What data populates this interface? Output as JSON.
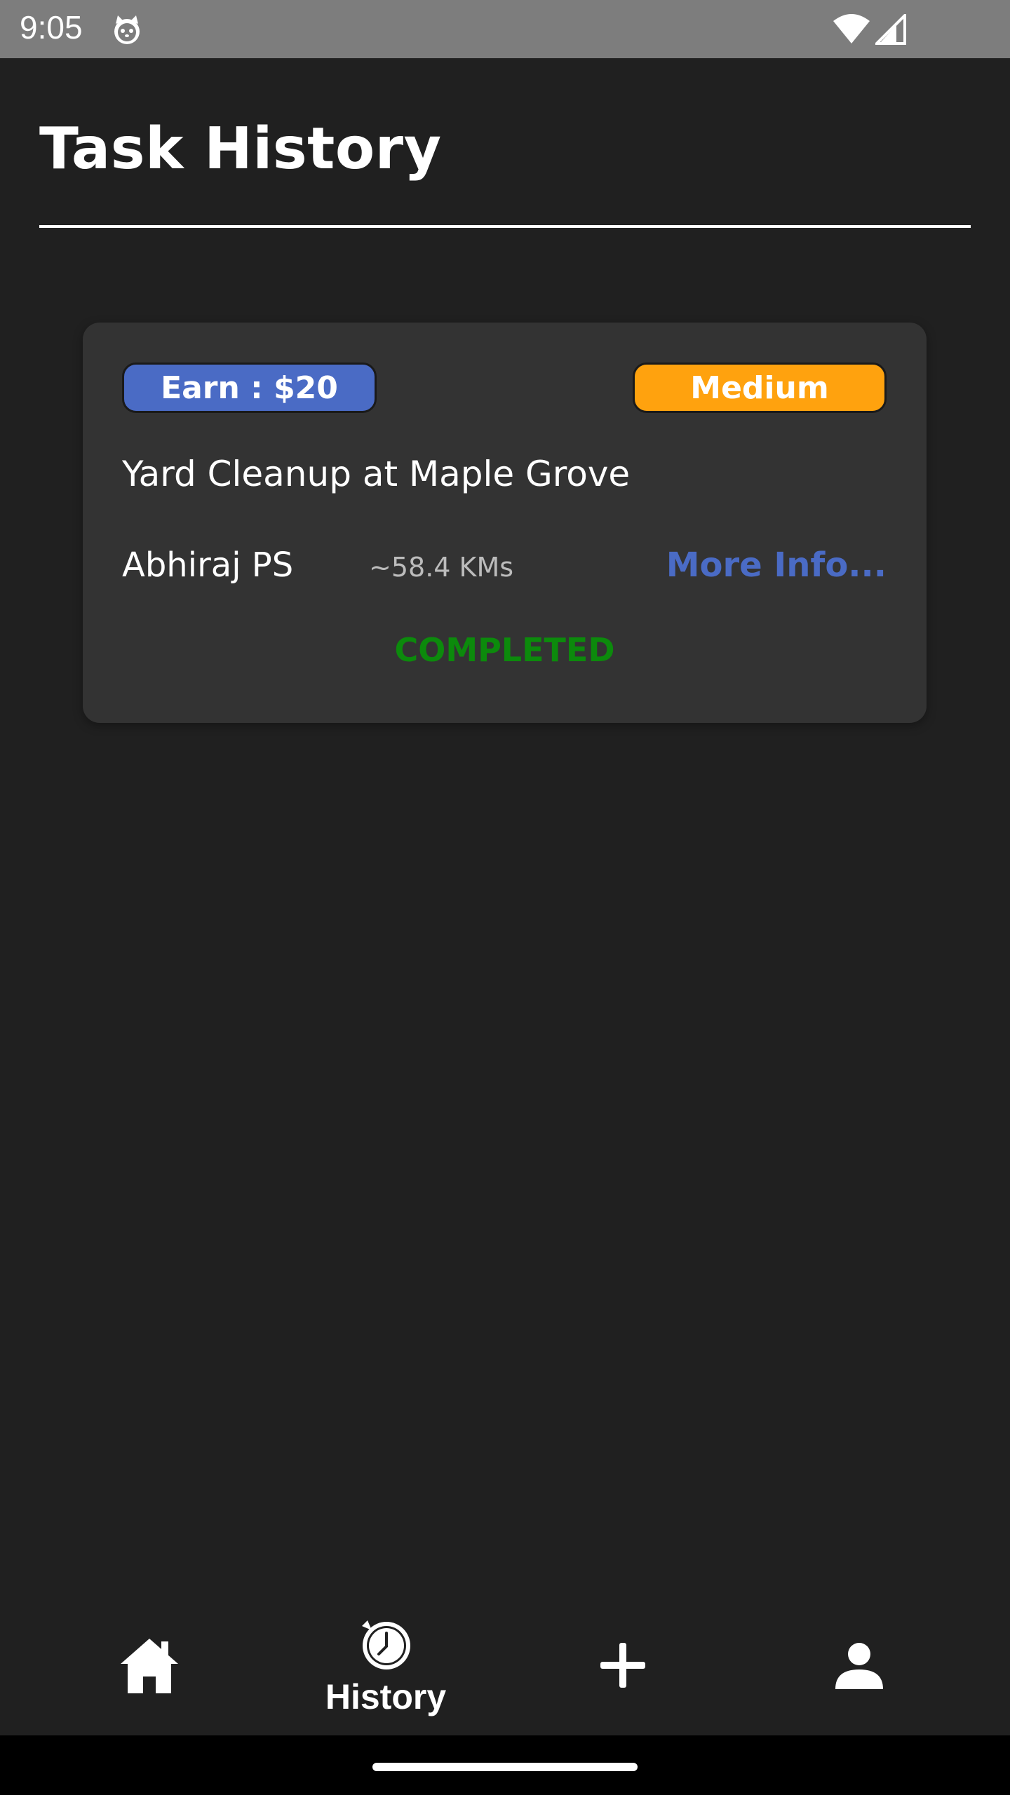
{
  "status_bar": {
    "time": "9:05",
    "icons": [
      "cat-notification-icon",
      "wifi-icon",
      "signal-icon"
    ]
  },
  "page": {
    "title": "Task History"
  },
  "tasks": [
    {
      "earn_label": "Earn : $20",
      "difficulty": "Medium",
      "title": "Yard Cleanup at Maple Grove",
      "poster": "Abhiraj PS",
      "distance": "~58.4 KMs",
      "more_info_label": "More Info...",
      "status": "COMPLETED"
    }
  ],
  "bottom_nav": {
    "items": [
      {
        "icon": "home-icon",
        "label": ""
      },
      {
        "icon": "history-icon",
        "label": "History",
        "active": true
      },
      {
        "icon": "add-icon",
        "label": ""
      },
      {
        "icon": "profile-icon",
        "label": ""
      }
    ]
  },
  "colors": {
    "background": "#202020",
    "card": "#333333",
    "earn_badge": "#4a6bc5",
    "difficulty_badge": "#ffa20e",
    "more_info": "#4a6bc5",
    "completed": "#0c8a0c"
  }
}
